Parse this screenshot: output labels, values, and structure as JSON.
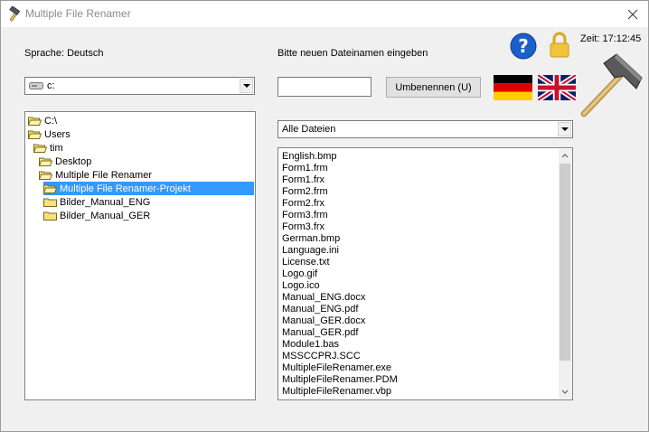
{
  "window": {
    "title": "Multiple File Renamer",
    "time": "Zeit: 17:12:45"
  },
  "language_label": "Sprache: Deutsch",
  "rename_prompt": "Bitte neuen Dateinamen eingeben",
  "drive": {
    "value": "c:"
  },
  "filename_input": {
    "value": ""
  },
  "rename_button": "Umbenennen (U)",
  "filter": {
    "value": "Alle Dateien"
  },
  "tree": [
    {
      "label": "C:\\",
      "open": true
    },
    {
      "label": "Users",
      "open": true
    },
    {
      "label": "tim",
      "open": true
    },
    {
      "label": "Desktop",
      "open": true
    },
    {
      "label": "Multiple File Renamer",
      "open": true
    },
    {
      "label": "Multiple File Renamer-Projekt",
      "open": true,
      "selected": true
    },
    {
      "label": "Bilder_Manual_ENG",
      "open": false
    },
    {
      "label": "Bilder_Manual_GER",
      "open": false
    }
  ],
  "files": [
    "English.bmp",
    "Form1.frm",
    "Form1.frx",
    "Form2.frm",
    "Form2.frx",
    "Form3.frm",
    "Form3.frx",
    "German.bmp",
    "Language.ini",
    "License.txt",
    "Logo.gif",
    "Logo.ico",
    "Manual_ENG.docx",
    "Manual_ENG.pdf",
    "Manual_GER.docx",
    "Manual_GER.pdf",
    "Module1.bas",
    "MSSCCPRJ.SCC",
    "MultipleFileRenamer.exe",
    "MultipleFileRenamer.PDM",
    "MultipleFileRenamer.vbp"
  ],
  "colors": {
    "selection": "#3399ff",
    "help_icon": "#1b60c8",
    "lock_icon": "#f2c43c"
  },
  "icons": {
    "app": "hammer-icon",
    "help": "question-icon",
    "lock": "lock-icon",
    "german_flag": "german-flag-icon",
    "english_flag": "uk-flag-icon",
    "logo": "hammer-logo-icon"
  }
}
